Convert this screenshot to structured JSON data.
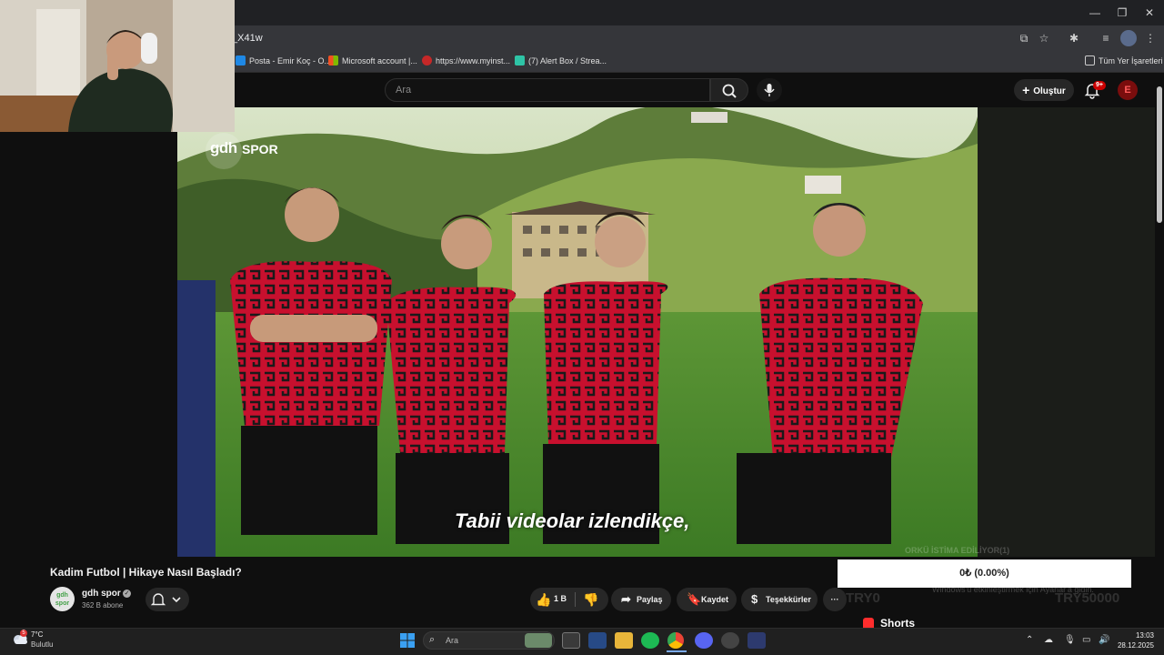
{
  "browser": {
    "url_fragment": "_X41w",
    "bookmarks": [
      {
        "label": "Posta - Emir Koç - O...",
        "color": "#1e88e5"
      },
      {
        "label": "Microsoft account |...",
        "color": "#f25022"
      },
      {
        "label": "https://www.myinst...",
        "color": "#c62828"
      },
      {
        "label": "(7) Alert Box / Strea...",
        "color": "#2ec4a6"
      }
    ],
    "all_bookmarks_label": "Tüm Yer İşaretleri"
  },
  "youtube": {
    "search_placeholder": "Ara",
    "create_label": "Oluştur",
    "notification_count": "9+",
    "avatar_letter": "E"
  },
  "video": {
    "channel_logo_text_1": "gdh",
    "channel_logo_text_2": "SPOR",
    "subtitle": "Tabii videolar izlendikçe,",
    "title": "Kadim Futbol | Hikaye Nasıl Başladı?",
    "channel_name": "gdh spor",
    "channel_avatar_text": "gdh spor",
    "subscribers": "362 B abone",
    "likes": "1 B",
    "share_label": "Paylaş",
    "save_label": "Kaydet",
    "thanks_label": "Teşekkürler",
    "more_label": "···"
  },
  "overlay": {
    "goal_text": "0₺ (0.00%)",
    "faded_title": "ORKÜ İSTİMA EDİLİYOR(1)",
    "faded_note": "Windows'u etkinleştirmek için Ayarlar'a gidin.",
    "faded_left": "TRY0",
    "faded_right": "TRY50000"
  },
  "sidebar": {
    "shorts_label": "Shorts"
  },
  "taskbar": {
    "temperature": "7°C",
    "weather_desc": "Bulutlu",
    "weather_badge": "5",
    "search_placeholder": "Ara",
    "time": "13:03",
    "date": "28.12.2025"
  },
  "colors": {
    "accent_red": "#cc0000",
    "jersey_red": "#c8102e",
    "grass": "#4f8a2c"
  }
}
